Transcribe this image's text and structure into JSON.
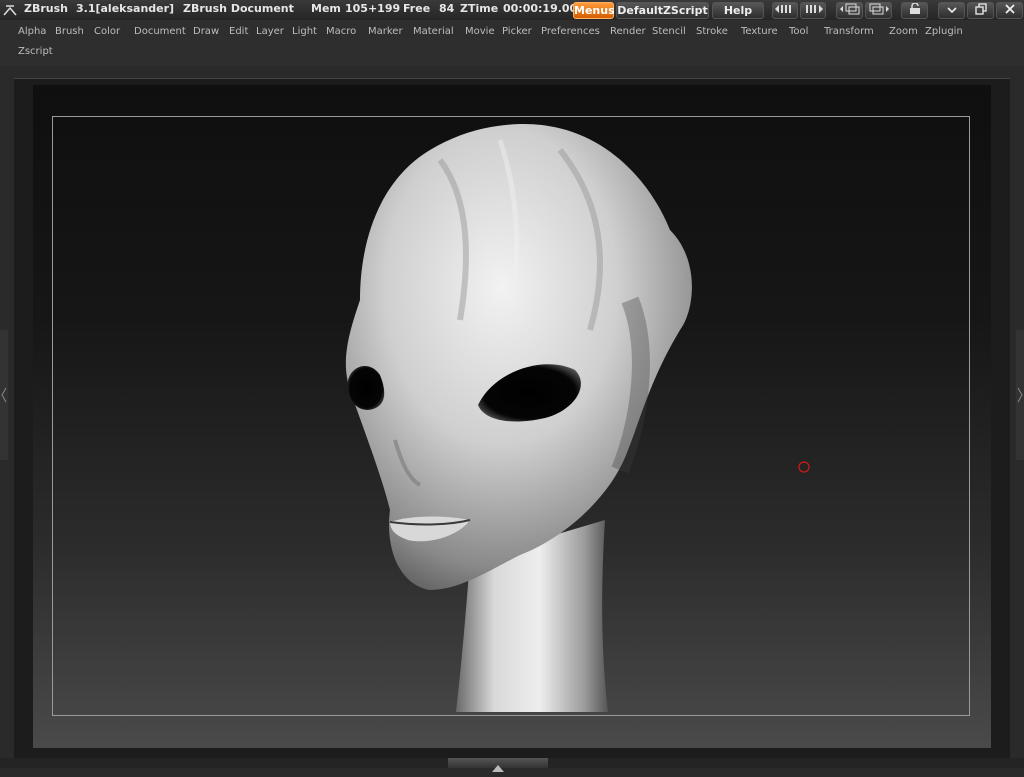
{
  "app": {
    "name": "ZBrush",
    "version_user": "3.1[aleksander]",
    "document_label": "ZBrush Document",
    "mem_label": "Mem",
    "mem_value": "105+199",
    "free_label": "Free",
    "free_value": "84",
    "ztime_label": "ZTime",
    "ztime_value": "00:00:19.00"
  },
  "toolbar": {
    "menus_label": "Menus",
    "script_label": "DefaultZScript",
    "help_label": "Help"
  },
  "menus": [
    "Alpha",
    "Brush",
    "Color",
    "Document",
    "Draw",
    "Edit",
    "Layer",
    "Light",
    "Macro",
    "Marker",
    "Material",
    "Movie",
    "Picker",
    "Preferences",
    "Render",
    "Stencil",
    "Stroke",
    "Texture",
    "Tool",
    "Transform",
    "Zoom",
    "Zplugin",
    "Zscript"
  ],
  "icons": {
    "logo": "zbrush-logo-icon",
    "undo_redo": "scroll-arrows-icon",
    "layout": "layout-icon",
    "lock": "lock-icon",
    "minimize": "minimize-icon",
    "restore": "restore-icon",
    "close": "close-icon",
    "cursor": "brush-cursor-icon"
  },
  "colors": {
    "accent": "#e8780c",
    "cursor": "#d01a1a"
  }
}
